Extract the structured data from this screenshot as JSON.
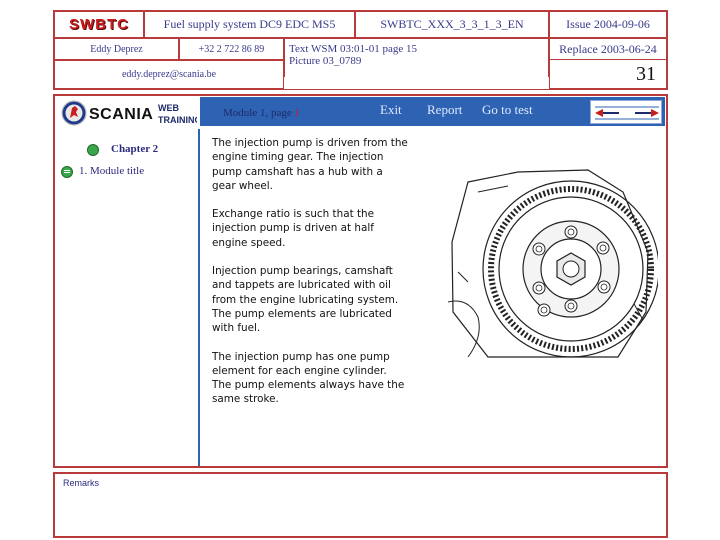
{
  "header": {
    "brand": "SWBTC",
    "course_title": "Fuel supply system DC9 EDC MS5",
    "doc_code": "SWBTC_XXX_3_3_1_3_EN",
    "issue": "Issue 2004-09-06",
    "author": "Eddy Deprez",
    "phone": "+32 2 722 86 89",
    "reference_line1": "Text WSM 03:01-01 page 15",
    "reference_line2": "Picture 03_0789",
    "replace": "Replace 2003-06-24",
    "email": "eddy.deprez@scania.be",
    "page_number": "31"
  },
  "navbar": {
    "logo_text": "SCANIA",
    "web_label": "WEB",
    "training_label": "TRAINING",
    "module_prefix": "Module 1, page ",
    "module_page": "1",
    "exit": "Exit",
    "report": "Report",
    "goto_test": "Go to test"
  },
  "sidebar": {
    "chapter": "Chapter 2",
    "module_title": "1. Module title"
  },
  "content": {
    "p1": "The injection pump is driven from the engine timing gear. The injection pump camshaft has a hub with a gear wheel.",
    "p2": "Exchange ratio is such that the injection pump is driven at half engine speed.",
    "p3": "Injection pump bearings, camshaft and tappets are lubricated with oil from the engine lubricating system. The pump elements are lubricated with fuel.",
    "p4": "The injection pump has one pump element for each engine cylinder. The pump elements always have the same stroke."
  },
  "remarks": {
    "label": "Remarks"
  },
  "colors": {
    "border_red": "#b83a3a",
    "nav_blue": "#2e62b3",
    "brand_red": "#c81e1e",
    "chapter_green": "#3aa64a"
  }
}
